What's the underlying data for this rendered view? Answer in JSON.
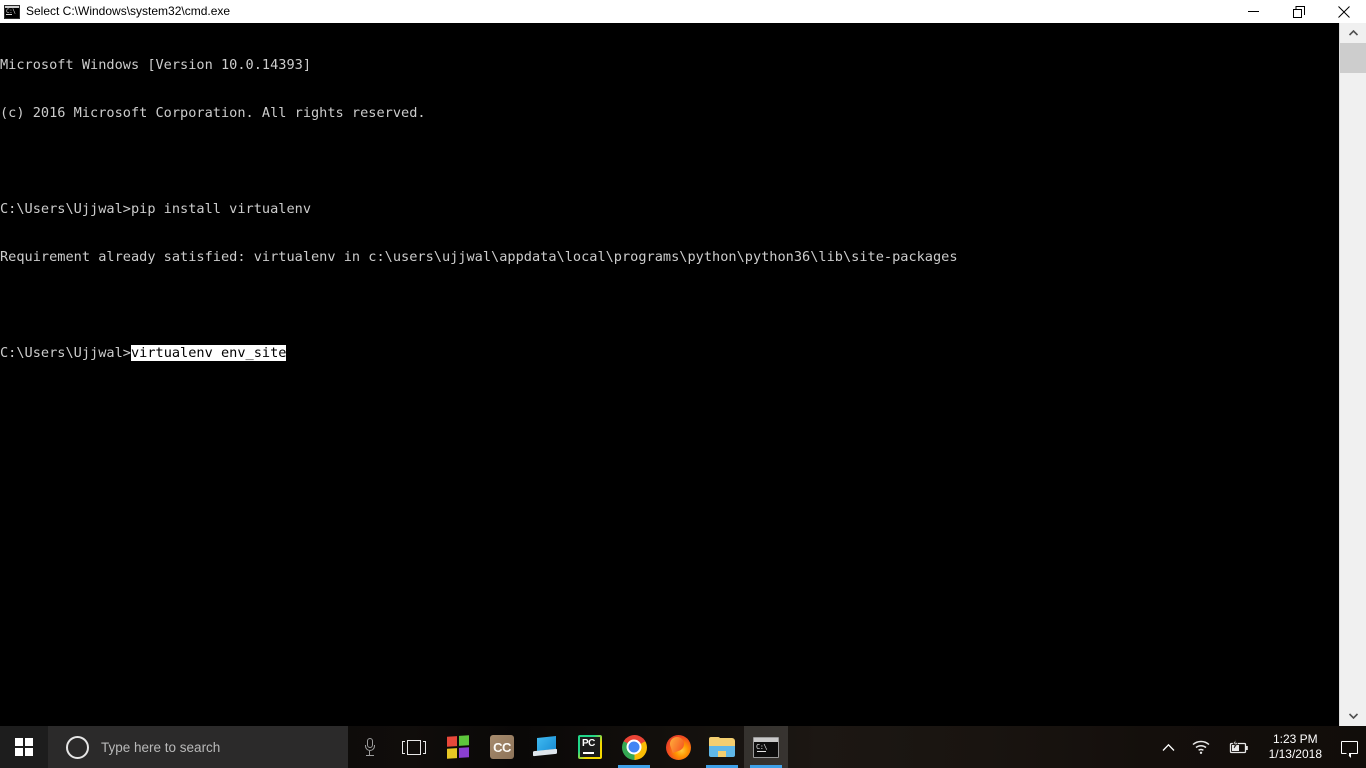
{
  "window": {
    "title": "Select C:\\Windows\\system32\\cmd.exe",
    "icon": "cmd-icon",
    "controls": {
      "minimize": "minimize",
      "restore": "restore",
      "close": "close"
    }
  },
  "console": {
    "lines": [
      {
        "text": "Microsoft Windows [Version 10.0.14393]",
        "selected": false
      },
      {
        "text": "(c) 2016 Microsoft Corporation. All rights reserved.",
        "selected": false
      },
      {
        "text": "",
        "selected": false
      },
      {
        "text": "C:\\Users\\Ujjwal>pip install virtualenv",
        "selected": false
      },
      {
        "text": "Requirement already satisfied: virtualenv in c:\\users\\ujjwal\\appdata\\local\\programs\\python\\python36\\lib\\site-packages",
        "selected": false
      },
      {
        "text": "",
        "selected": false
      },
      {
        "prefix": "C:\\Users\\Ujjwal>",
        "selection": "virtualenv env_site",
        "selected": true
      }
    ],
    "foreground": "#cccccc",
    "background": "#000000",
    "selection_background": "#ffffff",
    "selection_foreground": "#000000"
  },
  "scrollbar": {
    "up_arrow": "chevron-up",
    "down_arrow": "chevron-down",
    "thumb_color": "#cdcdcd",
    "track_color": "#f0f0f0"
  },
  "taskbar": {
    "start": "windows-logo",
    "search": {
      "placeholder": "Type here to search",
      "icon": "cortana-circle-icon"
    },
    "cortana_mic": "microphone-icon",
    "task_view": "task-view-icon",
    "apps": [
      {
        "name": "microsoft-store",
        "label": "Microsoft Store",
        "running": false,
        "active": false
      },
      {
        "name": "cc-app",
        "label": "CC",
        "running": false,
        "active": false
      },
      {
        "name": "remote-desktop",
        "label": "Remote Desktop",
        "running": false,
        "active": false
      },
      {
        "name": "pycharm",
        "label": "PyCharm",
        "running": false,
        "active": false
      },
      {
        "name": "google-chrome",
        "label": "Google Chrome",
        "running": true,
        "active": false
      },
      {
        "name": "mozilla-firefox",
        "label": "Mozilla Firefox",
        "running": false,
        "active": false
      },
      {
        "name": "file-explorer",
        "label": "File Explorer",
        "running": true,
        "active": false
      },
      {
        "name": "command-prompt",
        "label": "Command Prompt",
        "running": true,
        "active": true
      }
    ],
    "tray": {
      "show_hidden": "chevron-up-icon",
      "network": "wifi-icon",
      "battery": "battery-charging-icon",
      "time": "1:23 PM",
      "date": "1/13/2018",
      "action_center": "notification-icon"
    }
  }
}
